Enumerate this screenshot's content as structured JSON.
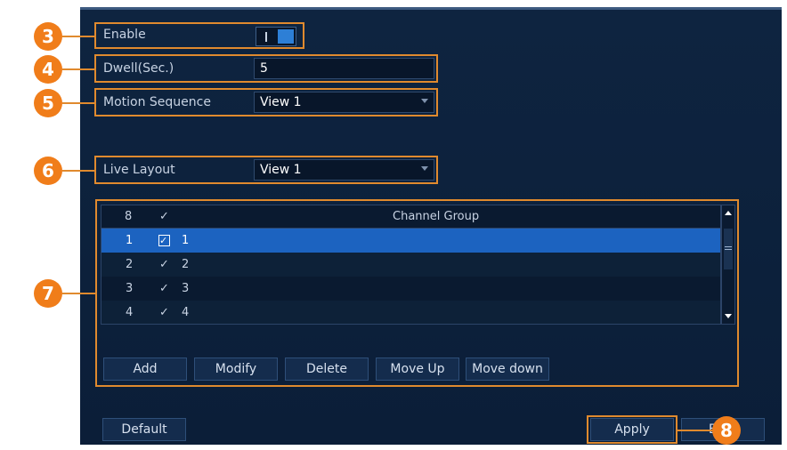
{
  "settings": {
    "enable_label": "Enable",
    "enable_on": true,
    "dwell_label": "Dwell(Sec.)",
    "dwell_value": "5",
    "motion_sequence_label": "Motion Sequence",
    "motion_sequence_value": "View 1",
    "live_layout_label": "Live Layout",
    "live_layout_value": "View 1"
  },
  "table": {
    "header_count": "8",
    "header_check": "✓",
    "header_title": "Channel Group",
    "rows": [
      {
        "index": "1",
        "check": "✓",
        "name": "1",
        "selected": true
      },
      {
        "index": "2",
        "check": "✓",
        "name": "2",
        "selected": false
      },
      {
        "index": "3",
        "check": "✓",
        "name": "3",
        "selected": false
      },
      {
        "index": "4",
        "check": "✓",
        "name": "4",
        "selected": false
      }
    ]
  },
  "actions": {
    "add": "Add",
    "modify": "Modify",
    "delete": "Delete",
    "move_up": "Move Up",
    "move_down": "Move down"
  },
  "footer": {
    "default": "Default",
    "apply": "Apply",
    "exit_partial": "E"
  },
  "callouts": {
    "enable": "3",
    "dwell": "4",
    "motion_sequence": "5",
    "live_layout": "6",
    "channel_group": "7",
    "apply": "8"
  },
  "colors": {
    "callout": "#f07d1a",
    "selection": "#1c63c0",
    "panel": "#0e2440"
  }
}
